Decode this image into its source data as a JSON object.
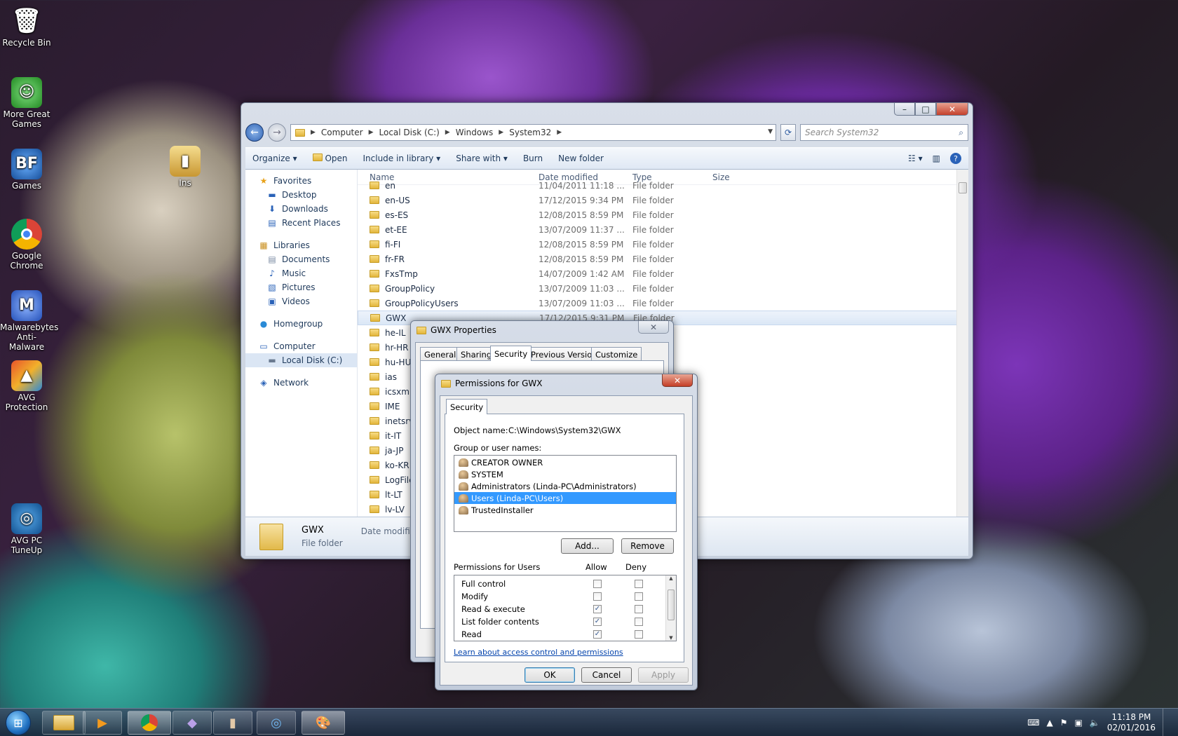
{
  "desktop": {
    "icons": [
      {
        "label": "Recycle Bin",
        "glyph": "🗑",
        "color": "#b8c2cc"
      },
      {
        "label": "More Great Games",
        "glyph": "☺",
        "color": "#3aa33a"
      },
      {
        "label": "Games",
        "glyph": "BF",
        "color": "#1f6ac2"
      },
      {
        "label": "Google Chrome",
        "glyph": "◉",
        "color": "#d93a2b"
      },
      {
        "label": "Malwarebytes Anti-Malware",
        "glyph": "M",
        "color": "#2d62c7"
      },
      {
        "label": "AVG Protection",
        "glyph": "▲",
        "color": "#e8542b"
      },
      {
        "label": "AVG PC TuneUp",
        "glyph": "◎",
        "color": "#1f78c0"
      },
      {
        "label": "Ins",
        "glyph": "▮",
        "color": "#d7b25a"
      }
    ]
  },
  "explorer": {
    "address": [
      "Computer",
      "Local Disk (C:)",
      "Windows",
      "System32"
    ],
    "search_placeholder": "Search System32",
    "toolbar": {
      "organize": "Organize",
      "open": "Open",
      "include": "Include in library",
      "share": "Share with",
      "burn": "Burn",
      "new_folder": "New folder"
    },
    "nav": {
      "favorites": "Favorites",
      "desktop": "Desktop",
      "downloads": "Downloads",
      "recent": "Recent Places",
      "libraries": "Libraries",
      "documents": "Documents",
      "music": "Music",
      "pictures": "Pictures",
      "videos": "Videos",
      "homegroup": "Homegroup",
      "computer": "Computer",
      "local_disk": "Local Disk (C:)",
      "network": "Network"
    },
    "columns": {
      "name": "Name",
      "date": "Date modified",
      "type": "Type",
      "size": "Size"
    },
    "rows": [
      {
        "name": "en",
        "date": "11/04/2011 11:18 ...",
        "type": "File folder"
      },
      {
        "name": "en-US",
        "date": "17/12/2015 9:34 PM",
        "type": "File folder"
      },
      {
        "name": "es-ES",
        "date": "12/08/2015 8:59 PM",
        "type": "File folder"
      },
      {
        "name": "et-EE",
        "date": "13/07/2009 11:37 ...",
        "type": "File folder"
      },
      {
        "name": "fi-FI",
        "date": "12/08/2015 8:59 PM",
        "type": "File folder"
      },
      {
        "name": "fr-FR",
        "date": "12/08/2015 8:59 PM",
        "type": "File folder"
      },
      {
        "name": "FxsTmp",
        "date": "14/07/2009 1:42 AM",
        "type": "File folder"
      },
      {
        "name": "GroupPolicy",
        "date": "13/07/2009 11:03 ...",
        "type": "File folder"
      },
      {
        "name": "GroupPolicyUsers",
        "date": "13/07/2009 11:03 ...",
        "type": "File folder"
      },
      {
        "name": "GWX",
        "date": "17/12/2015 9:31 PM",
        "type": "File folder"
      },
      {
        "name": "he-IL",
        "date": "",
        "type": ""
      },
      {
        "name": "hr-HR",
        "date": "",
        "type": ""
      },
      {
        "name": "hu-HU",
        "date": "",
        "type": ""
      },
      {
        "name": "ias",
        "date": "",
        "type": ""
      },
      {
        "name": "icsxml",
        "date": "",
        "type": ""
      },
      {
        "name": "IME",
        "date": "",
        "type": ""
      },
      {
        "name": "inetsrv",
        "date": "",
        "type": ""
      },
      {
        "name": "it-IT",
        "date": "",
        "type": ""
      },
      {
        "name": "ja-JP",
        "date": "",
        "type": ""
      },
      {
        "name": "ko-KR",
        "date": "",
        "type": ""
      },
      {
        "name": "LogFiles",
        "date": "",
        "type": ""
      },
      {
        "name": "lt-LT",
        "date": "",
        "type": ""
      },
      {
        "name": "lv-LV",
        "date": "",
        "type": ""
      }
    ],
    "details": {
      "name": "GWX",
      "kind": "File folder",
      "date_label": "Date modified: 17/1"
    }
  },
  "props": {
    "title": "GWX Properties",
    "tabs": [
      "General",
      "Sharing",
      "Security",
      "Previous Versions",
      "Customize"
    ]
  },
  "perm": {
    "title": "Permissions for GWX",
    "tab": "Security",
    "object_label": "Object name:",
    "object_value": "C:\\Windows\\System32\\GWX",
    "group_label": "Group or user names:",
    "users": [
      "CREATOR OWNER",
      "SYSTEM",
      "Administrators (Linda-PC\\Administrators)",
      "Users (Linda-PC\\Users)",
      "TrustedInstaller"
    ],
    "selected_user": 3,
    "add": "Add...",
    "remove": "Remove",
    "perms_label": "Permissions for Users",
    "allow": "Allow",
    "deny": "Deny",
    "permissions": [
      {
        "name": "Full control",
        "allow": false,
        "deny": false
      },
      {
        "name": "Modify",
        "allow": false,
        "deny": false
      },
      {
        "name": "Read & execute",
        "allow": true,
        "deny": false
      },
      {
        "name": "List folder contents",
        "allow": true,
        "deny": false
      },
      {
        "name": "Read",
        "allow": true,
        "deny": false
      }
    ],
    "learn": "Learn about access control and permissions",
    "ok": "OK",
    "cancel": "Cancel",
    "apply": "Apply"
  },
  "taskbar": {
    "time": "11:18 PM",
    "date": "02/01/2016"
  }
}
